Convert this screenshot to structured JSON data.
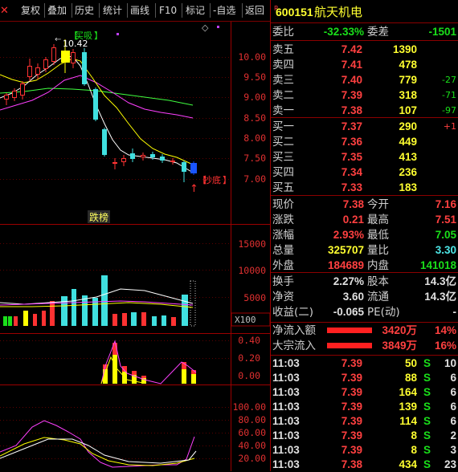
{
  "toolbar": {
    "close": "✕",
    "buttons": [
      "复权",
      "叠加",
      "历史",
      "统计",
      "画线",
      "F10",
      "标记",
      "-自选",
      "返回"
    ]
  },
  "chart": {
    "price_axis": [
      "10.00",
      "9.50",
      "9.00",
      "8.50",
      "8.00",
      "7.50",
      "7.00"
    ],
    "volume_axis": [
      "15000",
      "10000",
      "5000"
    ],
    "volume_unit": "X100",
    "indicator1_axis": [
      "0.40",
      "0.20",
      "0.00"
    ],
    "indicator2_axis": [
      "100.00",
      "80.00",
      "60.00",
      "40.00",
      "20.00"
    ],
    "high_mark": "10.42",
    "annotations": {
      "buy": "买吸",
      "dip": "抄底",
      "dragon": "跌榜"
    },
    "colors": {
      "up": "#ff3232",
      "down": "#40e0e0",
      "ma5": "#ffffff",
      "ma10": "#ffff00",
      "ma20": "#ff40ff",
      "ma60": "#40ff40"
    }
  },
  "stock": {
    "r_mark": "R",
    "code": "600151",
    "name": "航天机电"
  },
  "weibi": {
    "label1": "委比",
    "value1": "-32.33%",
    "label2": "委差",
    "value2": "-1501"
  },
  "asks": [
    {
      "label": "卖五",
      "price": "7.42",
      "vol": "1390",
      "chg": ""
    },
    {
      "label": "卖四",
      "price": "7.41",
      "vol": "478",
      "chg": ""
    },
    {
      "label": "卖三",
      "price": "7.40",
      "vol": "779",
      "chg": "-27"
    },
    {
      "label": "卖二",
      "price": "7.39",
      "vol": "318",
      "chg": "-71"
    },
    {
      "label": "卖一",
      "price": "7.38",
      "vol": "107",
      "chg": "-97"
    }
  ],
  "bids": [
    {
      "label": "买一",
      "price": "7.37",
      "vol": "290",
      "chg": "+1"
    },
    {
      "label": "买二",
      "price": "7.36",
      "vol": "449",
      "chg": ""
    },
    {
      "label": "买三",
      "price": "7.35",
      "vol": "413",
      "chg": ""
    },
    {
      "label": "买四",
      "price": "7.34",
      "vol": "236",
      "chg": ""
    },
    {
      "label": "买五",
      "price": "7.33",
      "vol": "183",
      "chg": ""
    }
  ],
  "quote": [
    {
      "l1": "现价",
      "v1": "7.38",
      "l2": "今开",
      "v2": "7.16"
    },
    {
      "l1": "涨跌",
      "v1": "0.21",
      "l2": "最高",
      "v2": "7.51"
    },
    {
      "l1": "涨幅",
      "v1": "2.93%",
      "l2": "最低",
      "v2": "7.05"
    },
    {
      "l1": "总量",
      "v1": "325707",
      "l2": "量比",
      "v2": "3.30"
    },
    {
      "l1": "外盘",
      "v1": "184689",
      "l2": "内盘",
      "v2": "141018"
    }
  ],
  "stats": [
    {
      "l1": "换手",
      "v1": "2.27%",
      "l2": "股本",
      "v2": "14.3亿"
    },
    {
      "l1": "净资",
      "v1": "3.60",
      "l2": "流通",
      "v2": "14.3亿"
    },
    {
      "l1": "收益(二)",
      "v1": "-0.065",
      "l2": "PE(动)",
      "v2": "-"
    }
  ],
  "flows": [
    {
      "label": "净流入额",
      "value": "3420万",
      "pct": "14%"
    },
    {
      "label": "大宗流入",
      "value": "3849万",
      "pct": "16%"
    }
  ],
  "ticks": [
    {
      "time": "11:03",
      "price": "7.39",
      "vol": "50",
      "side": "S",
      "n": "10"
    },
    {
      "time": "11:03",
      "price": "7.39",
      "vol": "88",
      "side": "S",
      "n": "6"
    },
    {
      "time": "11:03",
      "price": "7.39",
      "vol": "164",
      "side": "S",
      "n": "6"
    },
    {
      "time": "11:03",
      "price": "7.39",
      "vol": "139",
      "side": "S",
      "n": "6"
    },
    {
      "time": "11:03",
      "price": "7.39",
      "vol": "114",
      "side": "S",
      "n": "6"
    },
    {
      "time": "11:03",
      "price": "7.39",
      "vol": "8",
      "side": "S",
      "n": "2"
    },
    {
      "time": "11:03",
      "price": "7.39",
      "vol": "8",
      "side": "S",
      "n": "3"
    },
    {
      "time": "11:03",
      "price": "7.38",
      "vol": "434",
      "side": "S",
      "n": "23"
    }
  ]
}
